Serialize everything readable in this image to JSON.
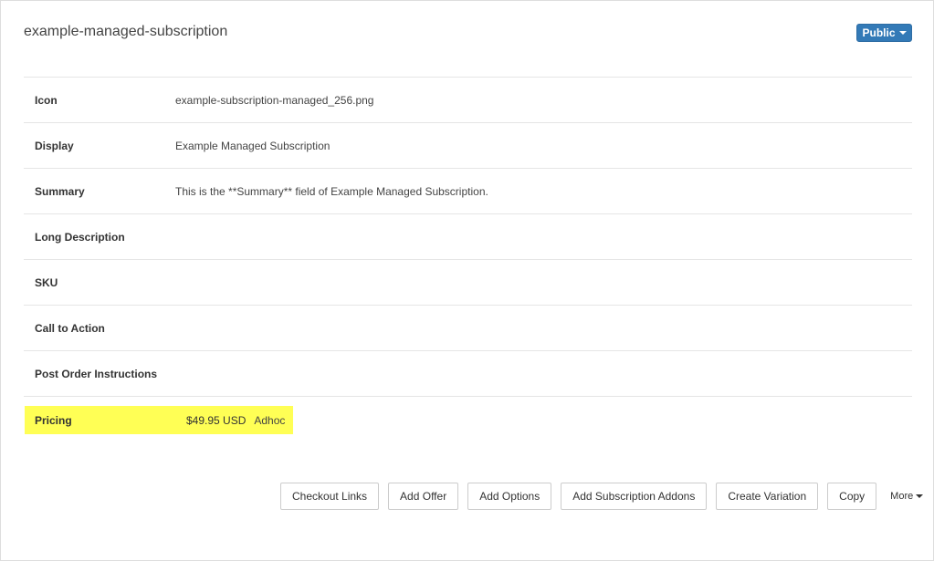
{
  "header": {
    "title": "example-managed-subscription",
    "status_label": "Public"
  },
  "properties": [
    {
      "label": "Icon",
      "value": "example-subscription-managed_256.png"
    },
    {
      "label": "Display",
      "value": "Example Managed Subscription"
    },
    {
      "label": "Summary",
      "value": "This is the **Summary** field of Example Managed Subscription."
    },
    {
      "label": "Long Description",
      "value": ""
    },
    {
      "label": "SKU",
      "value": ""
    },
    {
      "label": "Call to Action",
      "value": ""
    },
    {
      "label": "Post Order Instructions",
      "value": ""
    }
  ],
  "pricing": {
    "label": "Pricing",
    "amount": "$49.95 USD",
    "type": "Adhoc"
  },
  "actions": {
    "checkout_links": "Checkout Links",
    "add_offer": "Add Offer",
    "add_options": "Add Options",
    "add_subscription_addons": "Add Subscription Addons",
    "create_variation": "Create Variation",
    "copy": "Copy",
    "more": "More"
  },
  "colors": {
    "primary": "#337ab7",
    "highlight": "#ffff55"
  },
  "icons": {
    "dropdown": "caret-down-icon"
  }
}
